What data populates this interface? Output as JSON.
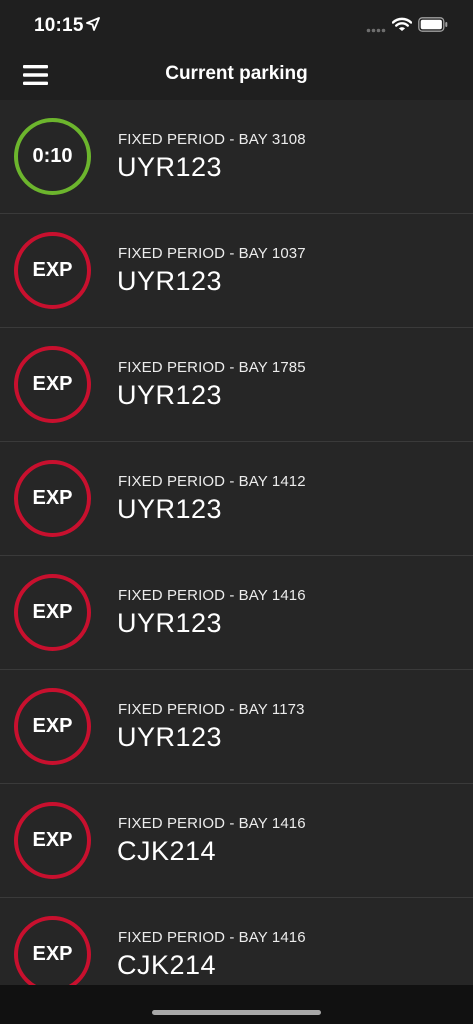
{
  "status_bar": {
    "time": "10:15"
  },
  "header": {
    "title": "Current parking"
  },
  "sessions": [
    {
      "timer": "0:10",
      "state": "active",
      "subtitle": "FIXED PERIOD - BAY 3108",
      "plate": "UYR123"
    },
    {
      "timer": "EXP",
      "state": "expired",
      "subtitle": "FIXED PERIOD - BAY 1037",
      "plate": "UYR123"
    },
    {
      "timer": "EXP",
      "state": "expired",
      "subtitle": "FIXED PERIOD - BAY 1785",
      "plate": "UYR123"
    },
    {
      "timer": "EXP",
      "state": "expired",
      "subtitle": "FIXED PERIOD - BAY 1412",
      "plate": "UYR123"
    },
    {
      "timer": "EXP",
      "state": "expired",
      "subtitle": "FIXED PERIOD - BAY 1416",
      "plate": "UYR123"
    },
    {
      "timer": "EXP",
      "state": "expired",
      "subtitle": "FIXED PERIOD - BAY 1173",
      "plate": "UYR123"
    },
    {
      "timer": "EXP",
      "state": "expired",
      "subtitle": "FIXED PERIOD - BAY 1416",
      "plate": "CJK214"
    },
    {
      "timer": "EXP",
      "state": "expired",
      "subtitle": "FIXED PERIOD - BAY 1416",
      "plate": "CJK214"
    }
  ],
  "colors": {
    "active_ring": "#6cb52d",
    "expired_ring": "#c8102e",
    "background": "#262626",
    "header": "#1f1f1f"
  },
  "icons": {
    "menu": "hamburger-menu-icon",
    "location": "location-arrow-icon",
    "wifi": "wifi-icon",
    "battery": "battery-icon",
    "signal": "cellular-signal-icon"
  }
}
